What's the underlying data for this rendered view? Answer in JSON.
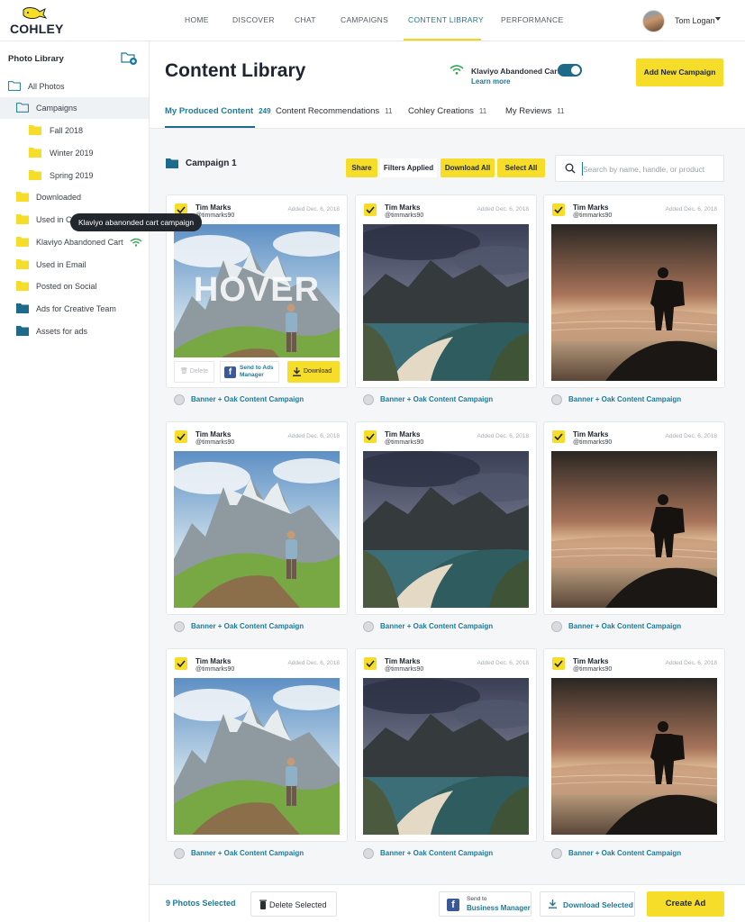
{
  "brand": {
    "name": "COHLEY",
    "accent_yellow": "#f5dd2a",
    "accent_teal": "#1d7a96"
  },
  "nav": {
    "items": [
      "HOME",
      "DISCOVER",
      "CHAT",
      "CAMPAIGNS",
      "CONTENT LIBRARY",
      "PERFORMANCE"
    ],
    "active": "CONTENT LIBRARY",
    "user_name": "Tom Logan"
  },
  "sidebar": {
    "title": "Photo Library",
    "items": [
      {
        "label": "All Photos",
        "icon": "folder-outline-icon"
      },
      {
        "label": "Campaigns",
        "icon": "folder-outline-icon"
      },
      {
        "label": "Fall 2018",
        "icon": "folder-yellow-icon"
      },
      {
        "label": "Winter 2019",
        "icon": "folder-yellow-icon"
      },
      {
        "label": "Spring 2019",
        "icon": "folder-yellow-icon"
      },
      {
        "label": "Downloaded",
        "icon": "folder-yellow-icon"
      },
      {
        "label": "Used in Campaign",
        "icon": "folder-yellow-icon"
      },
      {
        "label": "Klaviyo Abandoned Cart",
        "icon": "folder-yellow-icon"
      },
      {
        "label": "Used in Email",
        "icon": "folder-yellow-icon"
      },
      {
        "label": "Posted on Social",
        "icon": "folder-yellow-icon"
      },
      {
        "label": "Ads for Creative Team",
        "icon": "folder-teal-icon"
      },
      {
        "label": "Assets for ads",
        "icon": "folder-teal-icon"
      }
    ],
    "tooltip": "Klaviyo abanonded cart campaign"
  },
  "header": {
    "title": "Content Library",
    "integration_title": "Klaviyo Abandoned Cart",
    "integration_link": "Learn more",
    "integration_enabled": true,
    "new_campaign_label": "Add New Campaign"
  },
  "tabs": [
    {
      "label": "My Produced Content",
      "count": "249"
    },
    {
      "label": "Content Recommendations",
      "count": "11"
    },
    {
      "label": "Cohley Creations",
      "count": "11"
    },
    {
      "label": "My Reviews",
      "count": "11"
    }
  ],
  "toolbar": {
    "campaign_title": "Campaign 1",
    "share": "Share",
    "filters": "Filters Applied",
    "download_all": "Download All",
    "select_all": "Select All",
    "search_placeholder": "Search by name, handle, or product"
  },
  "cards": [
    {
      "name": "Tim Marks",
      "handle": "@timmarks90",
      "date": "Added Dec. 6, 2018",
      "campaign": "Banner + Oak Content Campaign",
      "image": "mountain-hiker",
      "hover": true
    },
    {
      "name": "Tim Marks",
      "handle": "@timmarks90",
      "date": "Added Dec. 6, 2018",
      "campaign": "Banner + Oak Content Campaign",
      "image": "coastal-cliffs",
      "hover": false
    },
    {
      "name": "Tim Marks",
      "handle": "@timmarks90",
      "date": "Added Dec. 6, 2018",
      "campaign": "Banner + Oak Content Campaign",
      "image": "sunset-silhouette",
      "hover": false
    },
    {
      "name": "Tim Marks",
      "handle": "@timmarks90",
      "date": "Added Dec. 6, 2018",
      "campaign": "Banner + Oak Content Campaign",
      "image": "mountain-hiker",
      "hover": false
    },
    {
      "name": "Tim Marks",
      "handle": "@timmarks90",
      "date": "Added Dec. 6, 2018",
      "campaign": "Banner + Oak Content Campaign",
      "image": "coastal-cliffs",
      "hover": false
    },
    {
      "name": "Tim Marks",
      "handle": "@timmarks90",
      "date": "Added Dec. 6, 2018",
      "campaign": "Banner + Oak Content Campaign",
      "image": "sunset-silhouette",
      "hover": false
    },
    {
      "name": "Tim Marks",
      "handle": "@timmarks90",
      "date": "Added Dec. 6, 2018",
      "campaign": "Banner + Oak Content Campaign",
      "image": "mountain-hiker",
      "hover": false
    },
    {
      "name": "Tim Marks",
      "handle": "@timmarks90",
      "date": "Added Dec. 6, 2018",
      "campaign": "Banner + Oak Content Campaign",
      "image": "coastal-cliffs",
      "hover": false
    },
    {
      "name": "Tim Marks",
      "handle": "@timmarks90",
      "date": "Added Dec. 6, 2018",
      "campaign": "Banner + Oak Content Campaign",
      "image": "sunset-silhouette",
      "hover": false
    }
  ],
  "hover_actions": {
    "overlay_text": "HOVER",
    "delete": "Delete",
    "send_to_ads_line1": "Send to Ads",
    "send_to_ads_line2": "Manager",
    "download": "Download"
  },
  "bottom_bar": {
    "selected_count": "9 Photos Selected",
    "delete_selected": "Delete Selected",
    "send_to_line1": "Send to",
    "send_to_line2": "Business Manager",
    "download_selected": "Download Selected",
    "create_ad": "Create Ad"
  }
}
